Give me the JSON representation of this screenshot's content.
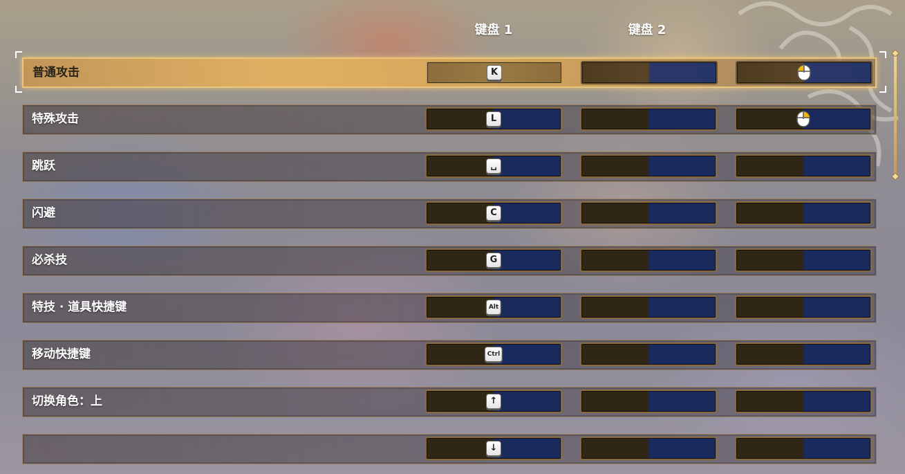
{
  "header": {
    "col1": "键盘 1",
    "col2": "键盘 2"
  },
  "colors": {
    "accent_gold": "#e9c67a",
    "slot_left": "#2f2615",
    "slot_right": "#1b2a5c"
  },
  "rows": [
    {
      "label": "普通攻击",
      "slot1": "K",
      "slot1_type": "key",
      "slot2": "",
      "slot3": "mouse-left-button-icon",
      "selected": true
    },
    {
      "label": "特殊攻击",
      "slot1": "L",
      "slot1_type": "key",
      "slot2": "",
      "slot3": "mouse-right-button-icon",
      "selected": false
    },
    {
      "label": "跳跃",
      "slot1": "␣",
      "slot1_type": "key",
      "slot2": "",
      "slot3": "",
      "selected": false
    },
    {
      "label": "闪避",
      "slot1": "C",
      "slot1_type": "key",
      "slot2": "",
      "slot3": "",
      "selected": false
    },
    {
      "label": "必杀技",
      "slot1": "G",
      "slot1_type": "key",
      "slot2": "",
      "slot3": "",
      "selected": false
    },
    {
      "label": "特技 · 道具快捷键",
      "slot1": "Alt",
      "slot1_type": "key",
      "slot2": "",
      "slot3": "",
      "selected": false
    },
    {
      "label": "移动快捷键",
      "slot1": "Ctrl",
      "slot1_type": "key",
      "slot2": "",
      "slot3": "",
      "selected": false
    },
    {
      "label": "切换角色：上",
      "slot1": "↑",
      "slot1_type": "key",
      "slot2": "",
      "slot3": "",
      "selected": false
    },
    {
      "label": "",
      "slot1": "↓",
      "slot1_type": "key",
      "slot2": "",
      "slot3": "",
      "selected": false
    }
  ]
}
